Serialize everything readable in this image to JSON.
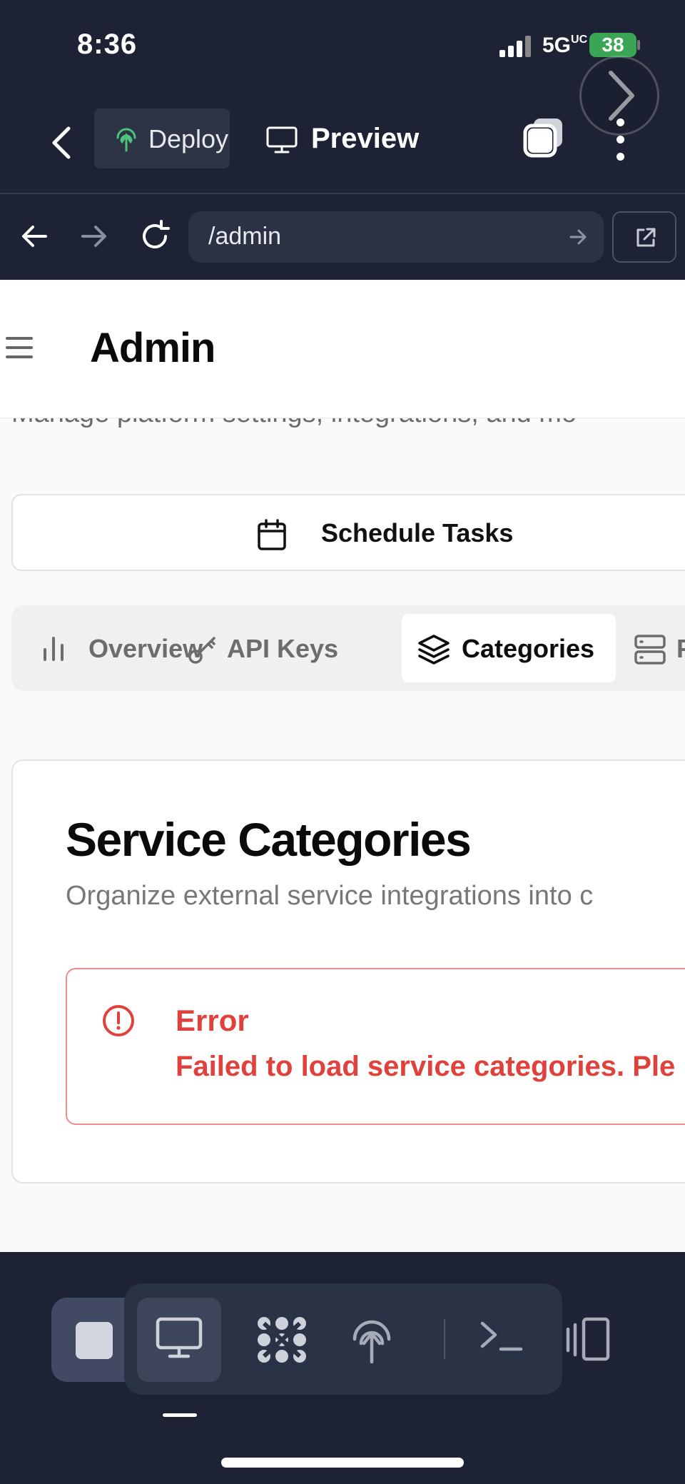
{
  "status_bar": {
    "time": "8:36",
    "network": "5G",
    "network_suffix": "UC",
    "battery": "38"
  },
  "toolbar": {
    "deploy_label": "Deploy",
    "preview_label": "Preview"
  },
  "urlbar": {
    "url": "/admin"
  },
  "header": {
    "title": "Admin",
    "subtitle": "Manage platform settings, integrations, and mo"
  },
  "schedule": {
    "label": "Schedule Tasks"
  },
  "tabs": [
    {
      "label": "Overview",
      "icon": "bar-chart-icon"
    },
    {
      "label": "API Keys",
      "icon": "key-icon"
    },
    {
      "label": "Categories",
      "icon": "layers-icon",
      "active": true
    },
    {
      "label": "P",
      "icon": "server-icon"
    }
  ],
  "card": {
    "title": "Service Categories",
    "description": "Organize external service integrations into c",
    "error_title": "Error",
    "error_message": "Failed to load service categories. Ple"
  },
  "colors": {
    "chrome_bg": "#1d2334",
    "accent_deploy": "#4ec27a",
    "error": "#e0413d",
    "battery": "#3aa655"
  },
  "dock": {
    "icons": [
      "stop-icon",
      "monitor-icon",
      "apps-icon",
      "deploy-icon",
      "terminal-icon",
      "device-icon"
    ]
  }
}
